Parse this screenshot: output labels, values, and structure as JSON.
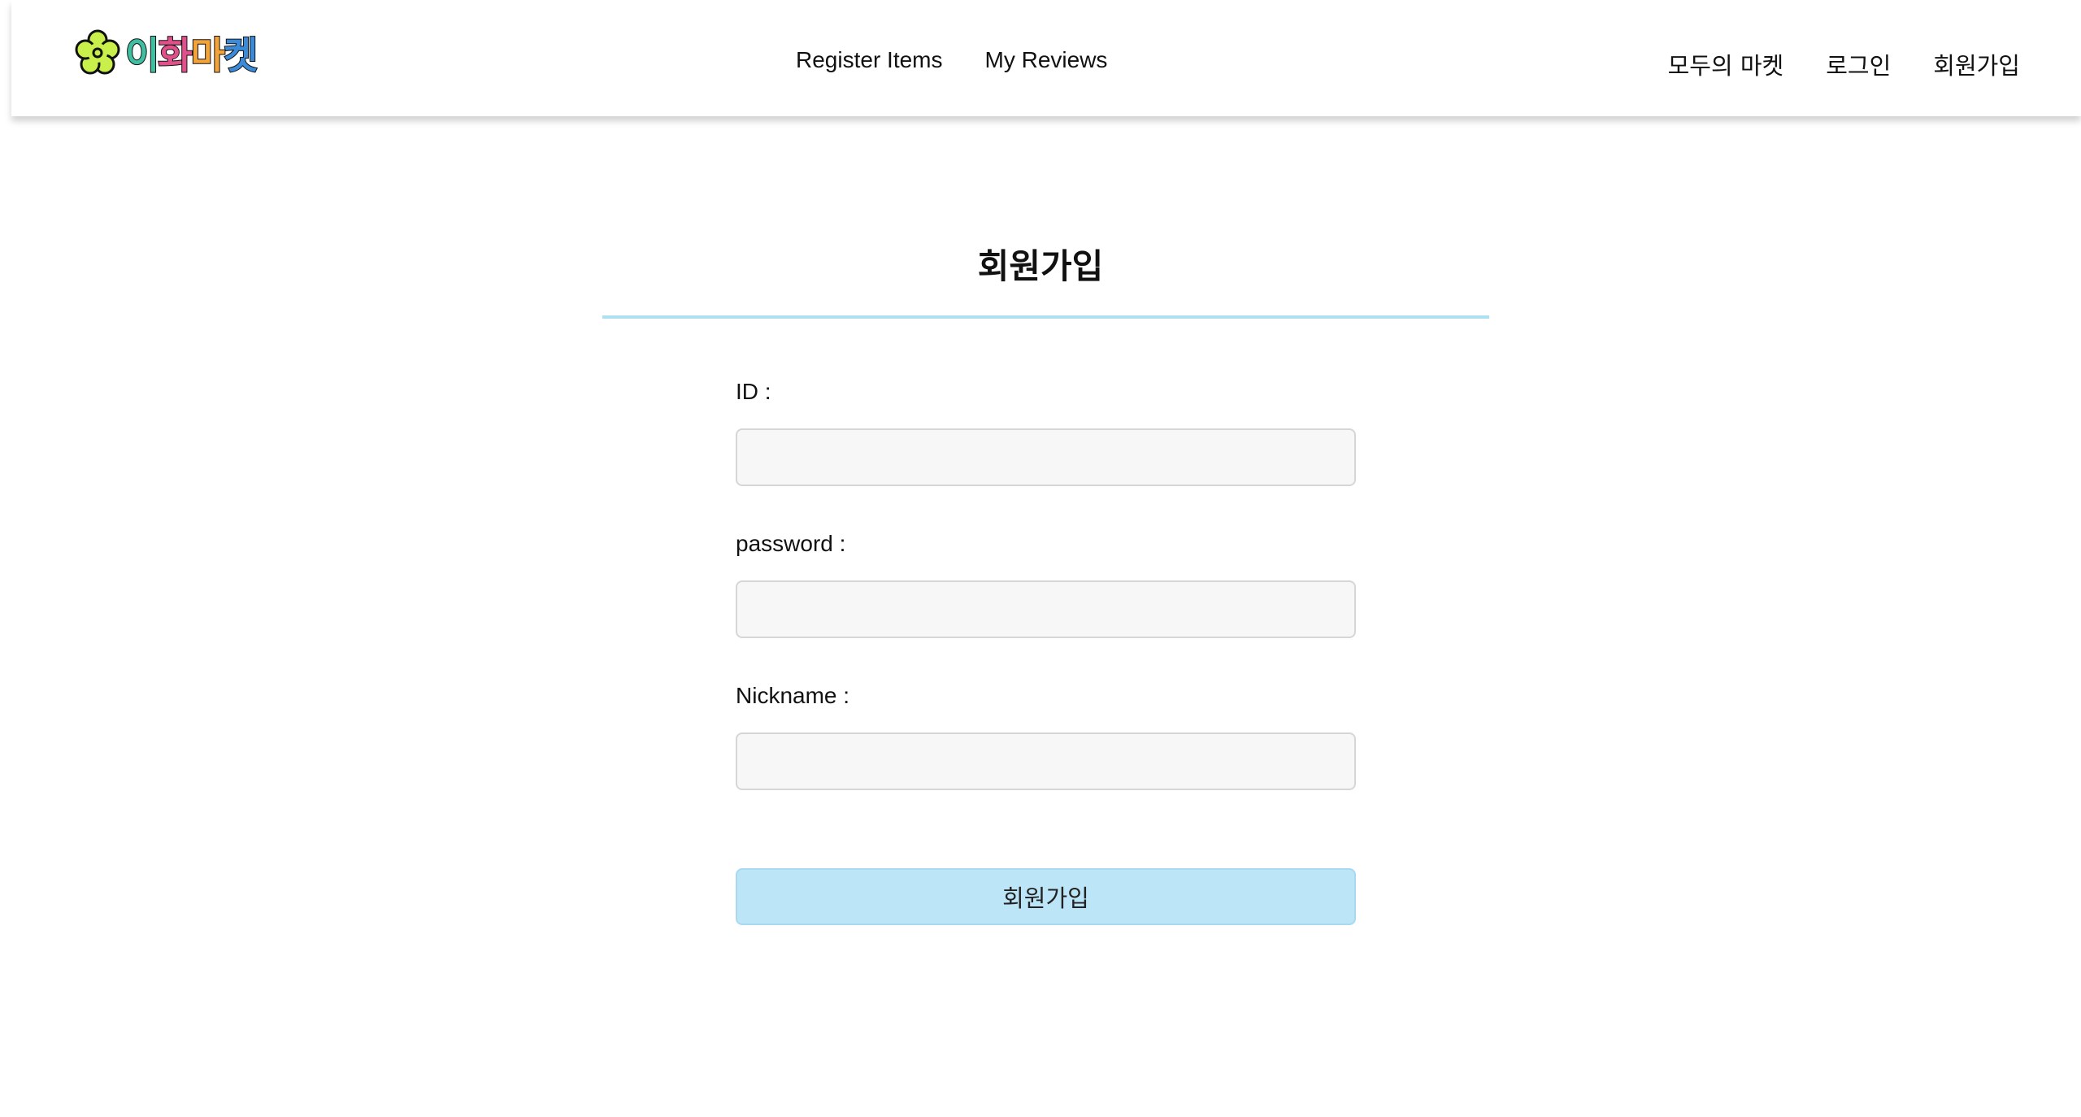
{
  "header": {
    "logo_text": [
      "이",
      "화",
      "마",
      "켓"
    ],
    "logo_colors": [
      "#3fbfa0",
      "#e0508a",
      "#f2a33a",
      "#3a8ad8"
    ],
    "nav_center": [
      "Register Items",
      "My Reviews"
    ],
    "nav_right": [
      "모두의 마켓",
      "로그인",
      "회원가입"
    ]
  },
  "page": {
    "title": "회원가입",
    "accent_color": "#aee0f2"
  },
  "form": {
    "id_label": "ID :",
    "id_value": "",
    "password_label": "password :",
    "password_value": "",
    "nickname_label": "Nickname :",
    "nickname_value": "",
    "submit_label": "회원가입"
  }
}
